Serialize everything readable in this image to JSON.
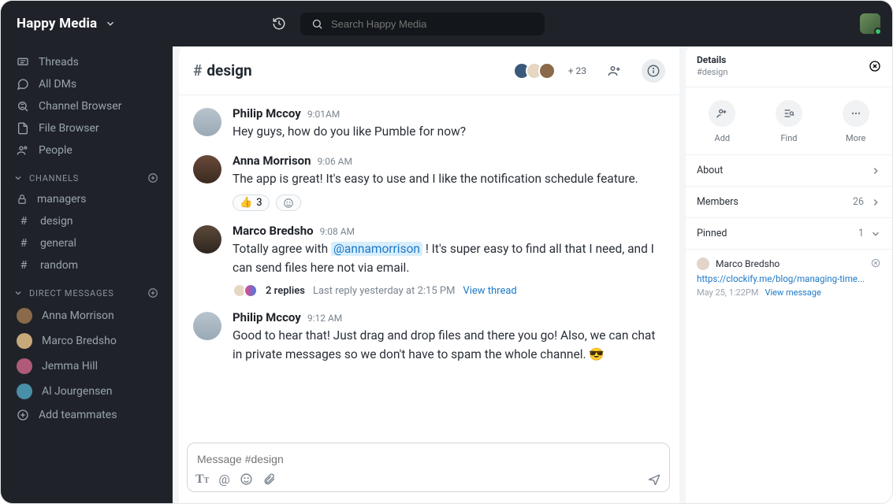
{
  "workspace": {
    "name": "Happy Media"
  },
  "search": {
    "placeholder": "Search Happy Media"
  },
  "sidebar": {
    "top": [
      {
        "label": "Threads"
      },
      {
        "label": "All DMs"
      },
      {
        "label": "Channel Browser"
      },
      {
        "label": "File Browser"
      },
      {
        "label": "People"
      }
    ],
    "channels_header": "CHANNELS",
    "channels": [
      {
        "label": "managers",
        "locked": true
      },
      {
        "label": "design",
        "locked": false
      },
      {
        "label": "general",
        "locked": false
      },
      {
        "label": "random",
        "locked": false
      }
    ],
    "dm_header": "DIRECT MESSAGES",
    "dms": [
      {
        "label": "Anna Morrison"
      },
      {
        "label": "Marco Bredsho"
      },
      {
        "label": "Jemma Hill"
      },
      {
        "label": "Al Jourgensen"
      }
    ],
    "add_teammates": "Add teammates"
  },
  "channel": {
    "name": "design",
    "plus_count": "+ 23"
  },
  "messages": [
    {
      "author": "Philip Mccoy",
      "time": "9:01AM",
      "text": "Hey guys, how do you like Pumble for now?"
    },
    {
      "author": "Anna Morrison",
      "time": "9:06 AM",
      "text": "The app is great! It's easy to use and I like the notification schedule feature.",
      "reaction_count": "3"
    },
    {
      "author": "Marco Bredsho",
      "time": "9:08 AM",
      "pre": "Totally agree with ",
      "mention": "@annamorrison",
      "post": " ! It's super easy to find all that I need, and I can send files here not via email.",
      "replies": "2 replies",
      "last_reply": "Last reply yesterday at 2:15 PM",
      "view_thread": "View thread"
    },
    {
      "author": "Philip Mccoy",
      "time": "9:12 AM",
      "text": "Good to hear that! Just drag and drop files and there you go! Also, we can chat in private messages so we don't have to spam the whole channel. 😎"
    }
  ],
  "composer": {
    "placeholder": "Message #design"
  },
  "details": {
    "title": "Details",
    "subtitle": "#design",
    "actions": {
      "add": "Add",
      "find": "Find",
      "more": "More"
    },
    "about": "About",
    "members_label": "Members",
    "members_count": "26",
    "pinned_label": "Pinned",
    "pinned_count": "1",
    "pinned": {
      "author": "Marco Bredsho",
      "link": "https://clockify.me/blog/managing-time...",
      "date": "May 25, 1:22PM",
      "view": "View message"
    }
  }
}
